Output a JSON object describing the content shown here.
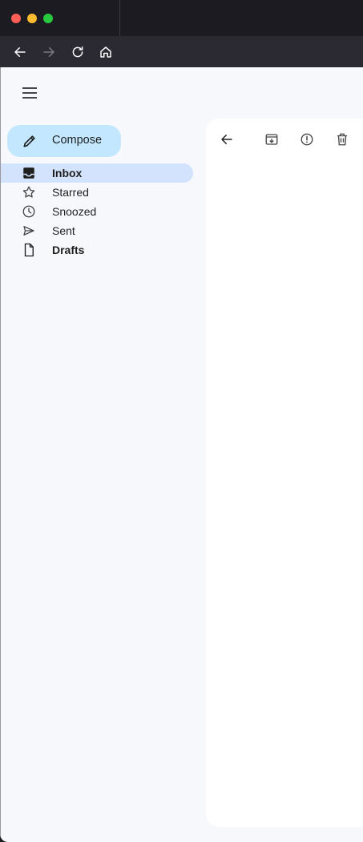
{
  "window": {
    "controls": [
      "close",
      "minimize",
      "maximize"
    ]
  },
  "browser": {
    "nav_icons": [
      "back-arrow-icon",
      "forward-arrow-icon",
      "reload-icon",
      "home-icon"
    ]
  },
  "sidebar": {
    "compose_label": "Compose",
    "items": [
      {
        "label": "Inbox",
        "icon": "inbox-icon",
        "active": true,
        "bold": true
      },
      {
        "label": "Starred",
        "icon": "star-icon",
        "active": false,
        "bold": false
      },
      {
        "label": "Snoozed",
        "icon": "clock-icon",
        "active": false,
        "bold": false
      },
      {
        "label": "Sent",
        "icon": "send-icon",
        "active": false,
        "bold": false
      },
      {
        "label": "Drafts",
        "icon": "draft-icon",
        "active": false,
        "bold": true
      }
    ]
  },
  "toolbar": {
    "icons": [
      "back-arrow-icon",
      "archive-icon",
      "report-spam-icon",
      "delete-icon"
    ]
  },
  "colors": {
    "accent": "#c2e7ff",
    "active_item": "#d3e3fd",
    "app_background": "#f6f8fc"
  }
}
